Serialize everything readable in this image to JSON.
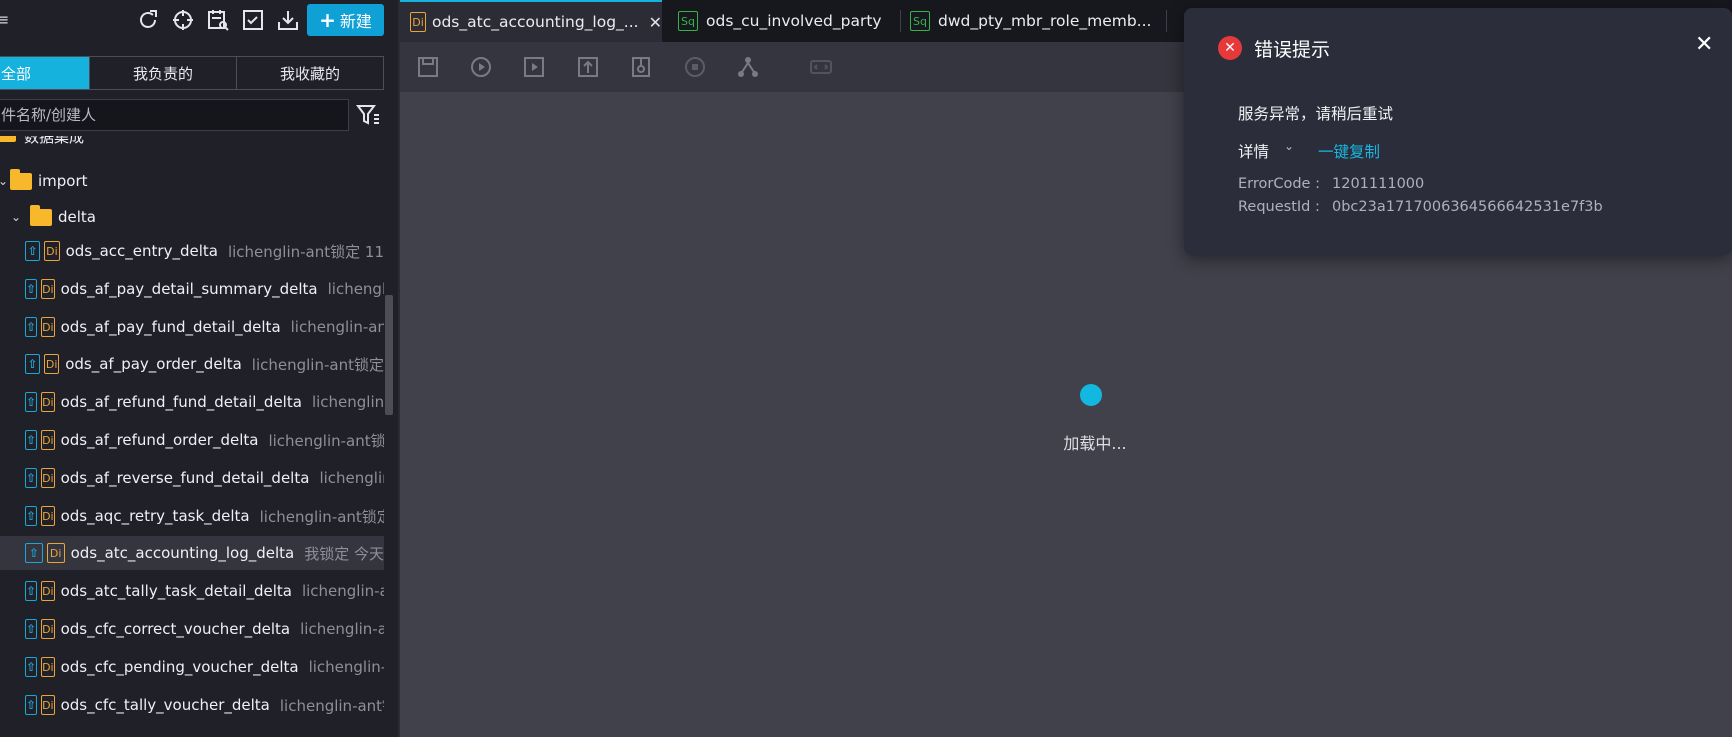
{
  "sidebar": {
    "new_button": "新建",
    "tabs": [
      "全部",
      "我负责的",
      "我收藏的"
    ],
    "search_placeholder": "件名称/创建人",
    "partial_folder": "数据集成",
    "folders": [
      {
        "label": "import"
      },
      {
        "label": "delta"
      }
    ],
    "files": [
      {
        "name": "ods_acc_entry_delta",
        "meta": "lichenglin-ant锁定  11"
      },
      {
        "name": "ods_af_pay_detail_summary_delta",
        "meta": "lichengli"
      },
      {
        "name": "ods_af_pay_fund_detail_delta",
        "meta": "lichenglin-ant"
      },
      {
        "name": "ods_af_pay_order_delta",
        "meta": "lichenglin-ant锁定"
      },
      {
        "name": "ods_af_refund_fund_detail_delta",
        "meta": "lichenglin-"
      },
      {
        "name": "ods_af_refund_order_delta",
        "meta": "lichenglin-ant锁"
      },
      {
        "name": "ods_af_reverse_fund_detail_delta",
        "meta": "lichenglin"
      },
      {
        "name": "ods_aqc_retry_task_delta",
        "meta": "lichenglin-ant锁定"
      },
      {
        "name": "ods_atc_accounting_log_delta",
        "meta": "我锁定  今天"
      },
      {
        "name": "ods_atc_tally_task_detail_delta",
        "meta": "lichenglin-a"
      },
      {
        "name": "ods_cfc_correct_voucher_delta",
        "meta": "lichenglin-a"
      },
      {
        "name": "ods_cfc_pending_voucher_delta",
        "meta": "lichenglin-"
      },
      {
        "name": "ods_cfc_tally_voucher_delta",
        "meta": "lichenglin-ant锁"
      }
    ]
  },
  "tabs": [
    {
      "badge": "Di",
      "label": "ods_atc_accounting_log_..."
    },
    {
      "badge": "Sq",
      "label": "ods_cu_involved_party"
    },
    {
      "badge": "Sq",
      "label": "dwd_pty_mbr_role_memb..."
    }
  ],
  "canvas": {
    "loading": "加载中..."
  },
  "error": {
    "title": "错误提示",
    "message": "服务异常，请稍后重试",
    "details_label": "详情",
    "copy_label": "一键复制",
    "error_code_key": "ErrorCode :",
    "error_code_value": "1201111000",
    "request_id_key": "RequestId :",
    "request_id_value": "0bc23a1717006364566642531e7f3b"
  }
}
